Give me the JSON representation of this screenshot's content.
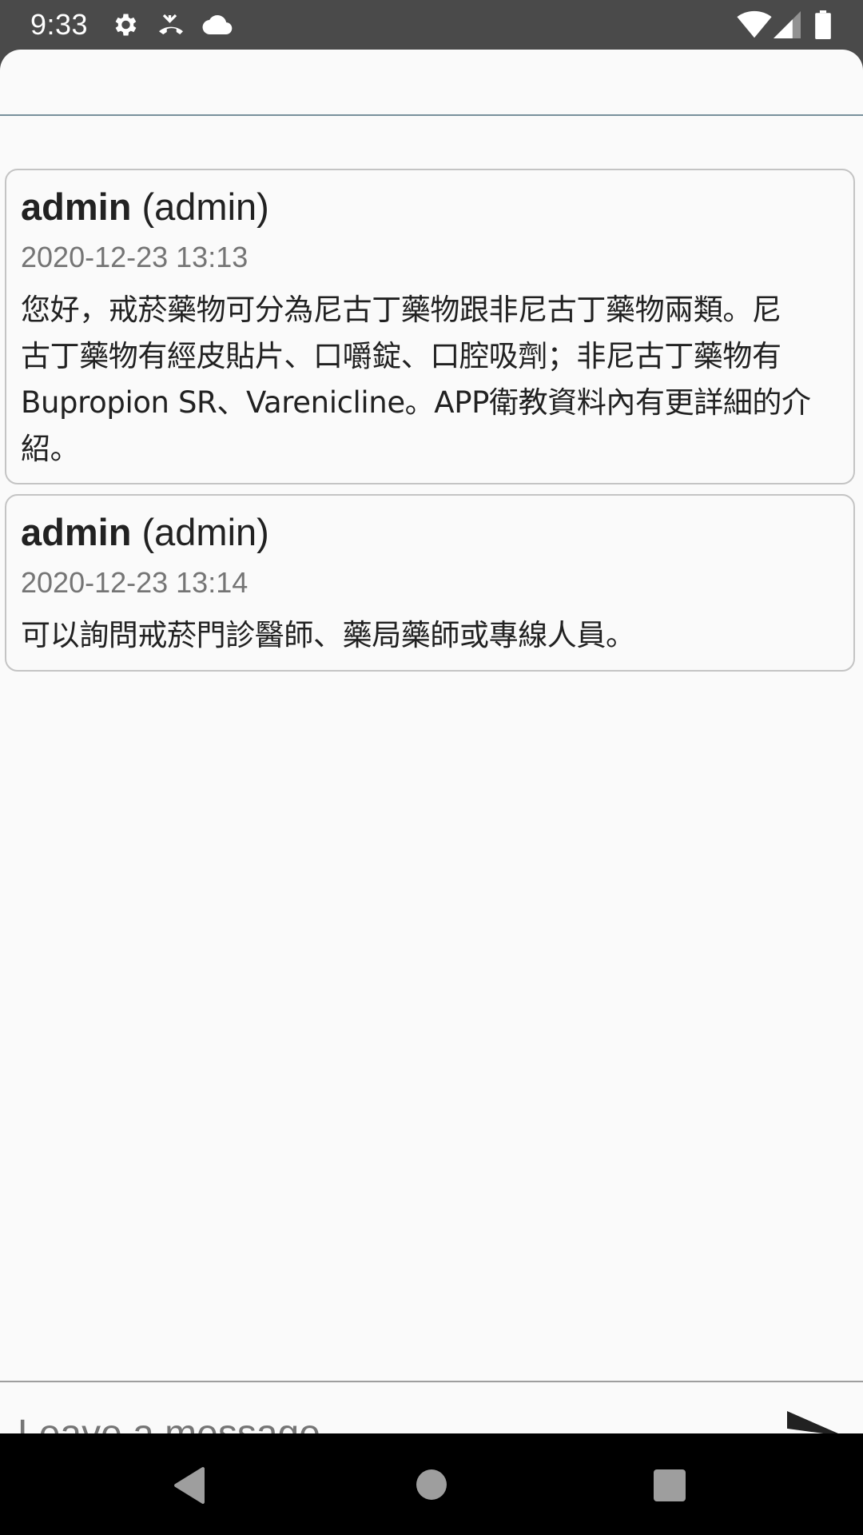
{
  "status_bar": {
    "time": "9:33",
    "icons": [
      "gear-icon",
      "missed-call-icon",
      "cloud-icon",
      "wifi-icon",
      "cell-signal-icon",
      "battery-icon"
    ]
  },
  "messages": [
    {
      "author_name": "admin",
      "author_role": "(admin)",
      "timestamp": "2020-12-23 13:13",
      "lines": [
        "您好，戒菸藥物可分為尼古丁藥物跟非尼古丁藥物兩類。尼",
        "古丁藥物有經皮貼片、口嚼錠、口腔吸劑；非尼古丁藥物有",
        "Bupropion SR、Varenicline。APP衛教資料內有更詳細的介",
        "紹。"
      ]
    },
    {
      "author_name": "admin",
      "author_role": "(admin)",
      "timestamp": "2020-12-23 13:14",
      "lines": [
        "可以詢問戒菸門診醫師、藥局藥師或專線人員。"
      ]
    }
  ],
  "composer": {
    "placeholder": "Leave a message",
    "value": "",
    "send_icon": "send-icon"
  },
  "nav_bar": {
    "buttons": [
      "back-icon",
      "home-icon",
      "recents-icon"
    ]
  },
  "colors": {
    "status_bar_bg": "#4a4a4a",
    "sheet_bg": "#fafafa",
    "header_divider": "#78909c",
    "card_border": "#c4c4c4",
    "nav_bar_bg": "#000000"
  }
}
